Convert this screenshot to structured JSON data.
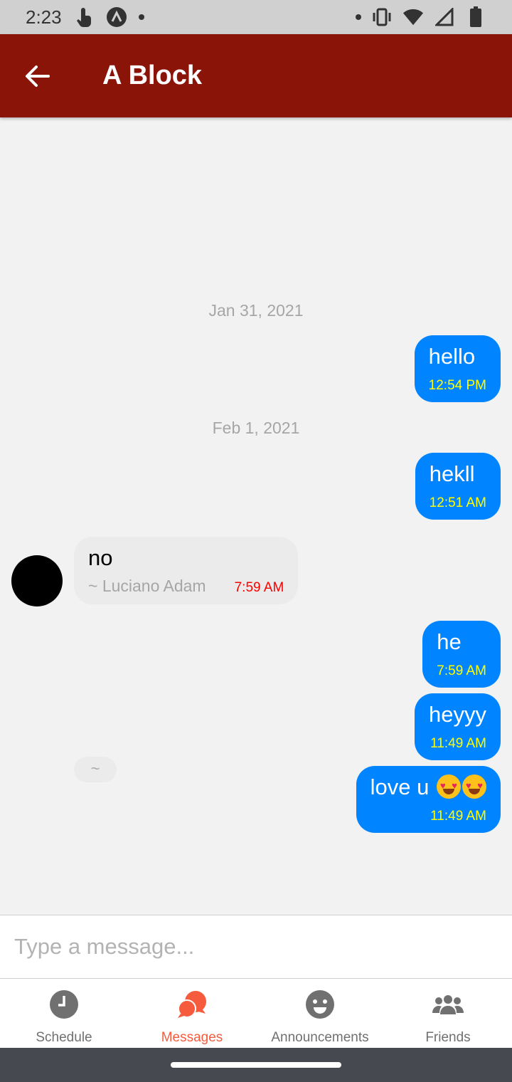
{
  "status_bar": {
    "time": "2:23"
  },
  "header": {
    "title": "A Block"
  },
  "chat": {
    "dates": [
      "Jan 31, 2021",
      "Feb 1, 2021"
    ],
    "outgoing": [
      {
        "text": "hello",
        "time": "12:54 PM"
      },
      {
        "text": "hekll",
        "time": "12:51 AM"
      },
      {
        "text": "he",
        "time": "7:59 AM"
      },
      {
        "text": "heyyy",
        "time": "11:49 AM"
      },
      {
        "text": "love u",
        "emoji": "heart-eyes-emoji",
        "time": "11:49 AM"
      }
    ],
    "incoming": [
      {
        "text": "no",
        "sender": "~ Luciano Adam",
        "time": "7:59 AM"
      }
    ],
    "typing_indicator": "~"
  },
  "input": {
    "placeholder": "Type a message..."
  },
  "nav": {
    "items": [
      {
        "label": "Schedule",
        "icon": "clock-icon"
      },
      {
        "label": "Messages",
        "icon": "chat-bubbles-icon"
      },
      {
        "label": "Announcements",
        "icon": "smiley-icon"
      },
      {
        "label": "Friends",
        "icon": "people-icon"
      }
    ],
    "active_color": "#f55b3c",
    "inactive_color": "#707070"
  },
  "colors": {
    "header": "#8b1409",
    "outgoing_bubble": "#0084ff",
    "outgoing_time": "#ffff00",
    "incoming_time": "#ff0000"
  }
}
